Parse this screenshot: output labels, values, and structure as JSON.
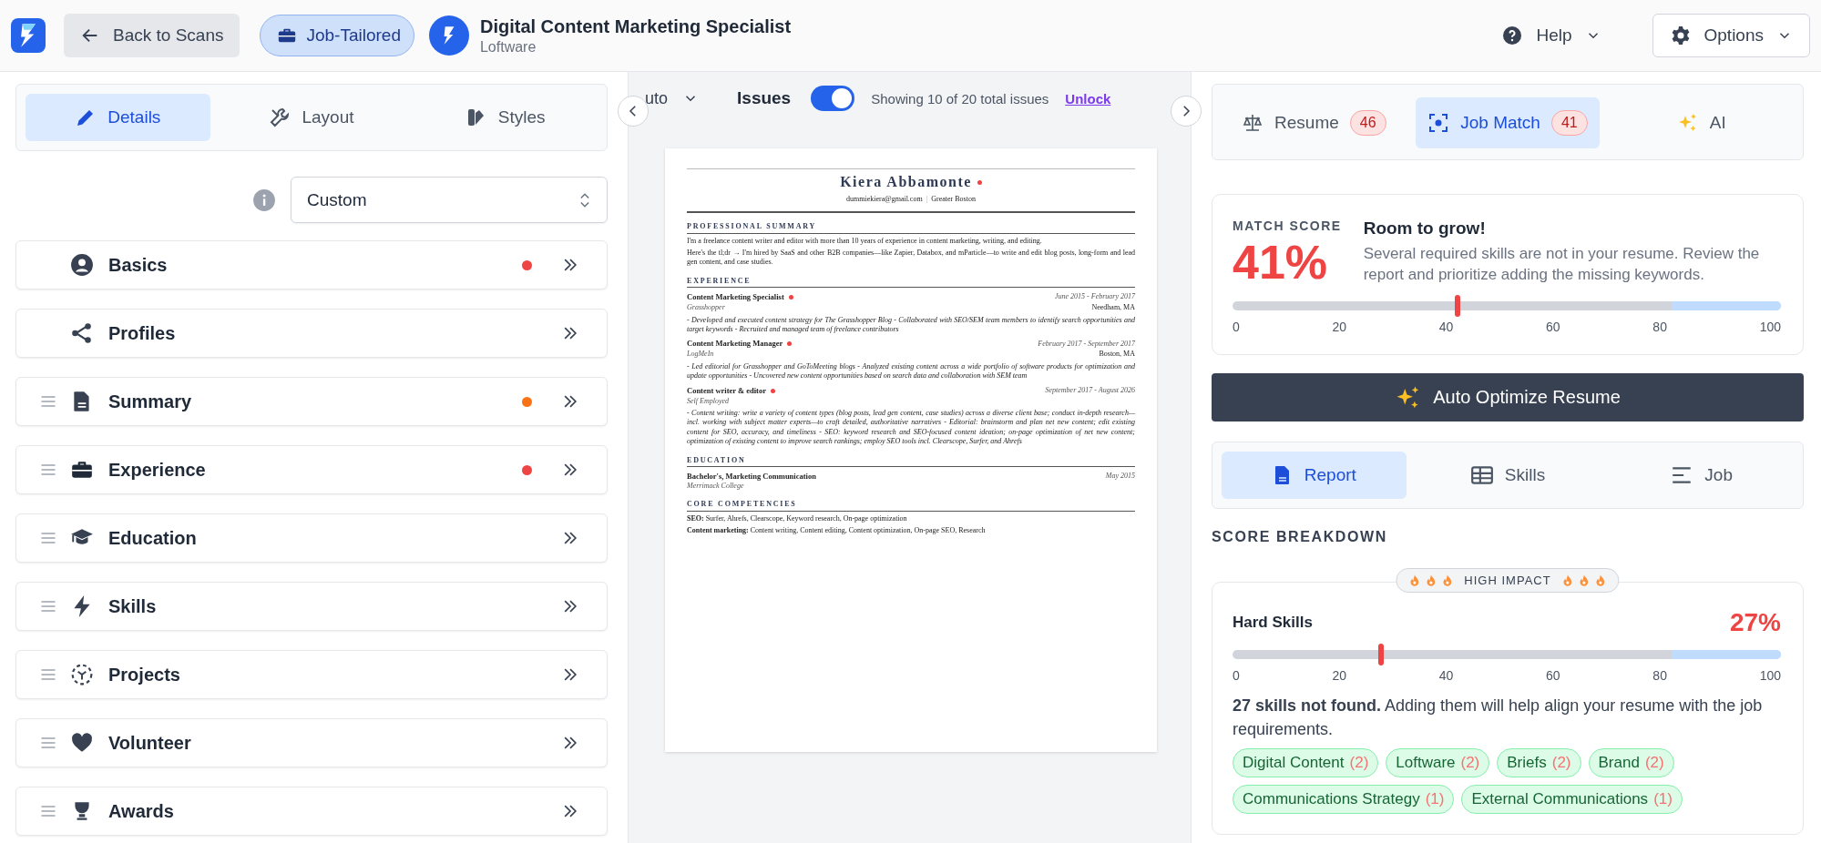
{
  "topbar": {
    "back_button": "Back to Scans",
    "mode_button": "Job-Tailored",
    "job_title": "Digital Content Marketing Specialist",
    "company": "Loftware",
    "help": "Help",
    "options": "Options"
  },
  "editor": {
    "tabs": [
      {
        "label": "Details",
        "selected": true
      },
      {
        "label": "Layout",
        "selected": false
      },
      {
        "label": "Styles",
        "selected": false
      }
    ],
    "template_select": {
      "value": "Custom"
    },
    "sections": [
      {
        "label": "Basics",
        "draggable": false,
        "color": "#ef4444"
      },
      {
        "label": "Profiles",
        "draggable": false
      },
      {
        "label": "Summary",
        "draggable": true,
        "color": "#f97316"
      },
      {
        "label": "Experience",
        "draggable": true,
        "color": "#ef4444"
      },
      {
        "label": "Education",
        "draggable": true
      },
      {
        "label": "Skills",
        "draggable": true
      },
      {
        "label": "Projects",
        "draggable": true
      },
      {
        "label": "Volunteer",
        "draggable": true
      },
      {
        "label": "Awards",
        "draggable": true
      }
    ]
  },
  "preview": {
    "toolbar": {
      "zoom": "uto",
      "issues_label": "Issues",
      "issues_on": true,
      "issues_count": "Showing 10 of 20 total issues",
      "unlock": "Unlock"
    },
    "resume": {
      "name": "Kiera Abbamonte",
      "flagged": true,
      "contact": [
        "dummiekiera@gmail.com",
        "Greater Boston"
      ],
      "contact_separator": "|",
      "summary_heading": "PROFESSIONAL SUMMARY",
      "summary": [
        "I'm a freelance content writer and editor with more than 10 years of experience in content marketing, writing, and editing.",
        "Here's the tl;dr → I'm hired by SaaS and other B2B companies—like Zapier, Databox, and mParticle—to write and edit blog posts, long-form and lead gen content, and case studies."
      ],
      "experience_heading": "EXPERIENCE",
      "experience": [
        {
          "title": "Content Marketing Specialist",
          "flagged": true,
          "dates": "June 2015 - February 2017",
          "company": "Grasshopper",
          "location": "Needham, MA",
          "description": "- Developed and executed content strategy for The Grasshopper Blog - Collaborated with SEO/SEM team members to identify search opportunities and target keywords - Recruited and managed team of freelance contributors"
        },
        {
          "title": "Content Marketing Manager",
          "flagged": true,
          "dates": "February 2017 - September 2017",
          "company": "LogMeIn",
          "location": "Boston, MA",
          "description": "- Led editorial for Grasshopper and GoToMeeting blogs - Analyzed existing content across a wide portfolio of software products for optimization and update opportunities - Uncovered new content opportunities based on search data and collaboration with SEM team"
        },
        {
          "title": "Content writer & editor",
          "flagged": true,
          "dates": "September 2017 - August 2026",
          "company": "Self Employed",
          "description": "- Content writing: write a variety of content types (blog posts, lead gen content, case studies) across a diverse client base; conduct in-depth research—incl. working with subject matter experts—to craft detailed, authoritative narratives - Editorial: brainstorm and plan net new content; edit existing content for SEO, accuracy, and timeliness - SEO: keyword research and SEO-focused content ideation; on-page optimization of net new content; optimization of existing content to improve search rankings; employ SEO tools incl. Clearscope, Surfer, and Ahrefs"
        }
      ],
      "education_heading": "EDUCATION",
      "education": [
        {
          "degree": "Bachelor's, Marketing Communication",
          "date": "May 2015",
          "school": "Merrimack College"
        }
      ],
      "competencies_heading": "CORE COMPETENCIES",
      "competencies": [
        "**SEO:** Surfer, Ahrefs, Clearscope, Keyword research, On-page optimization",
        "**Content marketing:** Content writing, Content editing, Content optimization, On-page SEO, Research"
      ]
    }
  },
  "analysis": {
    "tabs": [
      {
        "label": "Resume",
        "badge": "46",
        "selected": false
      },
      {
        "label": "Job Match",
        "badge": "41",
        "selected": true
      },
      {
        "label": "AI",
        "selected": false
      }
    ],
    "match": {
      "label": "MATCH SCORE",
      "score": "41%",
      "heading": "Room to grow!",
      "message": "Several required skills are not in your resume. Review the report and prioritize adding the missing keywords.",
      "level": 0.41,
      "ticks": [
        "0",
        "20",
        "40",
        "60",
        "80",
        "100"
      ]
    },
    "optimize_button": "Auto Optimize Resume",
    "report_tabs": [
      {
        "label": "Report",
        "selected": true
      },
      {
        "label": "Skills",
        "selected": false
      },
      {
        "label": "Job",
        "selected": false
      }
    ],
    "breakdown": {
      "title": "SCORE BREAKDOWN",
      "impact": "HIGH IMPACT",
      "category": "Hard Skills",
      "score": "27%",
      "level": 0.27,
      "ticks": [
        "0",
        "20",
        "40",
        "60",
        "80",
        "100"
      ],
      "summary": "**27 skills not found.** Adding them will help align your resume with the job requirements.",
      "missing_skills": [
        {
          "label": "Digital Content",
          "count": "(2)"
        },
        {
          "label": "Loftware",
          "count": "(2)"
        },
        {
          "label": "Briefs",
          "count": "(2)"
        },
        {
          "label": "Brand",
          "count": "(2)"
        },
        {
          "label": "Communications Strategy",
          "count": "(1)"
        },
        {
          "label": "External Communications",
          "count": "(1)"
        }
      ]
    }
  }
}
